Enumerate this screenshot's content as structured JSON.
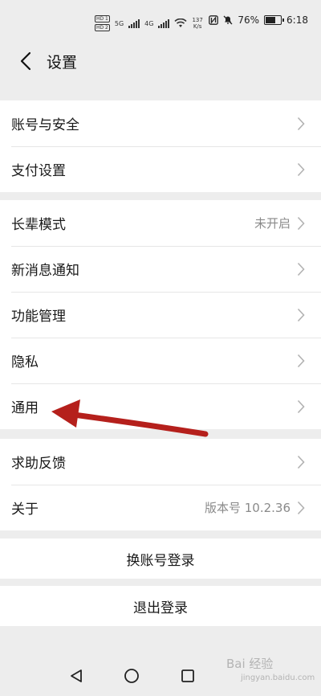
{
  "status_bar": {
    "hd1": "HD 1",
    "hd2": "HD 2",
    "net_type": "5G",
    "net_type2": "4G",
    "speed_value": "137",
    "speed_unit": "K/s",
    "battery_percent": "76%",
    "time": "6:18",
    "battery_level": 0.76
  },
  "header": {
    "title": "设置"
  },
  "groups": [
    {
      "items": [
        {
          "label": "账号与安全"
        },
        {
          "label": "支付设置"
        }
      ]
    },
    {
      "items": [
        {
          "label": "长辈模式",
          "value": "未开启"
        },
        {
          "label": "新消息通知"
        },
        {
          "label": "功能管理"
        },
        {
          "label": "隐私"
        },
        {
          "label": "通用"
        }
      ]
    },
    {
      "items": [
        {
          "label": "求助反馈"
        },
        {
          "label": "关于",
          "value": "版本号 10.2.36"
        }
      ]
    }
  ],
  "actions": {
    "switch_account": "换账号登录",
    "logout": "退出登录"
  },
  "watermark": {
    "brand": "Bai 经验",
    "sub": "jingyan.baidu.com"
  },
  "colors": {
    "background": "#ededed",
    "surface": "#ffffff",
    "text": "#191919",
    "secondary_text": "#8a8a8a",
    "arrow": "#b5201c"
  }
}
